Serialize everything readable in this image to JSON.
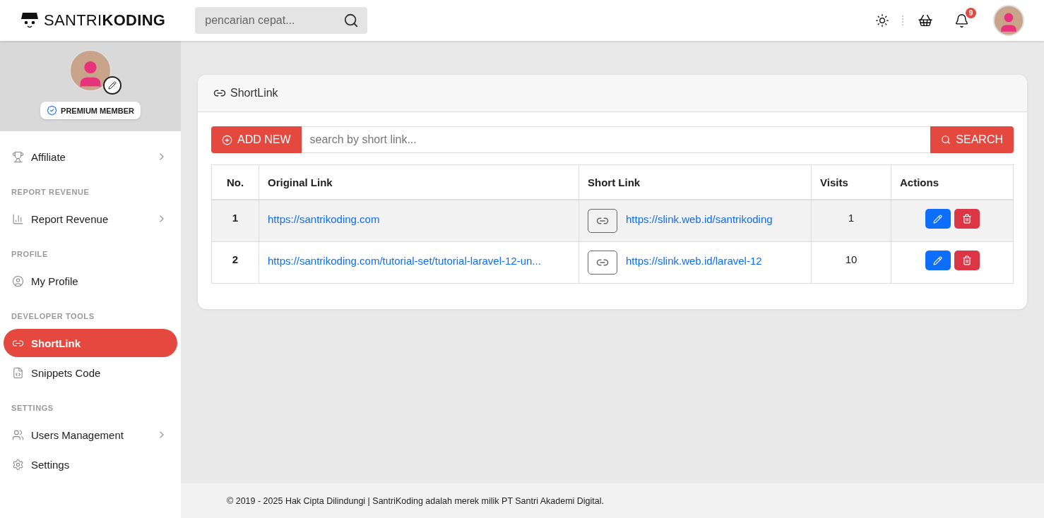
{
  "header": {
    "logo": "SANTRI**KODING**",
    "search": {
      "placeholder": "pencarian cepat..."
    },
    "notification_count": "9"
  },
  "sidebar": {
    "badge": "PREMIUM MEMBER",
    "groups": [
      {
        "items": [
          {
            "label": "Affiliate",
            "has_submenu": true,
            "selected": false
          }
        ]
      },
      {
        "heading": "REPORT REVENUE",
        "items": [
          {
            "label": "Report Revenue",
            "has_submenu": true,
            "selected": false
          }
        ]
      },
      {
        "heading": "PROFILE",
        "items": [
          {
            "label": "My Profile",
            "has_submenu": false,
            "selected": false
          }
        ]
      },
      {
        "heading": "DEVELOPER TOOLS",
        "items": [
          {
            "label": "ShortLink",
            "has_submenu": false,
            "selected": true
          },
          {
            "label": "Snippets Code",
            "has_submenu": false,
            "selected": false
          }
        ]
      },
      {
        "heading": "SETTINGS",
        "items": [
          {
            "label": "Users Management",
            "has_submenu": true,
            "selected": false
          },
          {
            "label": "Settings",
            "has_submenu": false,
            "selected": false
          }
        ]
      }
    ]
  },
  "card": {
    "title": "ShortLink",
    "add_button": "ADD NEW",
    "search": {
      "placeholder": "search by short link..."
    },
    "search_button": "SEARCH",
    "table": {
      "columns": [
        "No.",
        "Original Link",
        "Short Link",
        "Visits",
        "Actions"
      ],
      "rows": [
        {
          "no": "1",
          "original": "https://santrikoding.com",
          "short": "https://slink.web.id/santrikoding",
          "visits": "1"
        },
        {
          "no": "2",
          "original": "https://santrikoding.com/tutorial-set/tutorial-laravel-12-un...",
          "short": "https://slink.web.id/laravel-12",
          "visits": "10"
        }
      ]
    }
  },
  "footer": "© 2019 - 2025 Hak Cipta Dilindungi | SantriKoding adalah merek milik PT Santri Akademi Digital."
}
